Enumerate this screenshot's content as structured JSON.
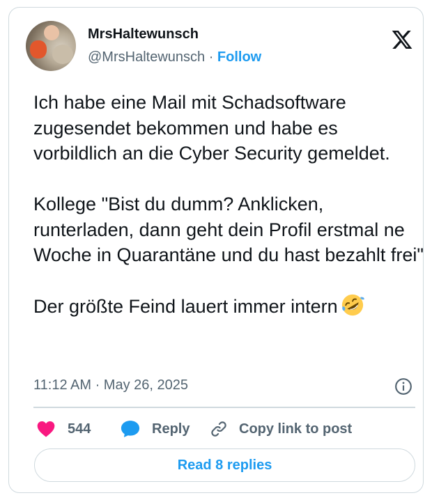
{
  "author": {
    "display_name": "MrsHaltewunsch",
    "handle": "@MrsHaltewunsch",
    "separator": "·",
    "follow_label": "Follow"
  },
  "tweet": {
    "paragraph_1": "Ich habe eine Mail mit Schadsoftware zugesendet bekommen und habe es vorbildlich an die Cyber Security gemeldet.",
    "paragraph_2": "Kollege \"Bist du dumm? Anklicken, runterladen, dann geht dein Profil erstmal ne Woche in Quarantäne und du hast bezahlt frei\"",
    "paragraph_3": "Der größte Feind lauert immer intern",
    "emoji": "rolling-on-floor-laughing-emoji",
    "timestamp": "11:12 AM · May 26, 2025"
  },
  "actions": {
    "like_count": "544",
    "reply_label": "Reply",
    "copy_link_label": "Copy link to post",
    "read_replies_label": "Read 8 replies"
  },
  "icons": {
    "logo": "x-logo-icon",
    "like": "heart-icon",
    "reply": "speech-bubble-icon",
    "copy": "link-icon",
    "info": "info-icon"
  },
  "colors": {
    "accent": "#1d9bf0",
    "heart": "#f91880",
    "text": "#0f1419",
    "secondary_text": "#536471",
    "border": "#cfd9de"
  }
}
